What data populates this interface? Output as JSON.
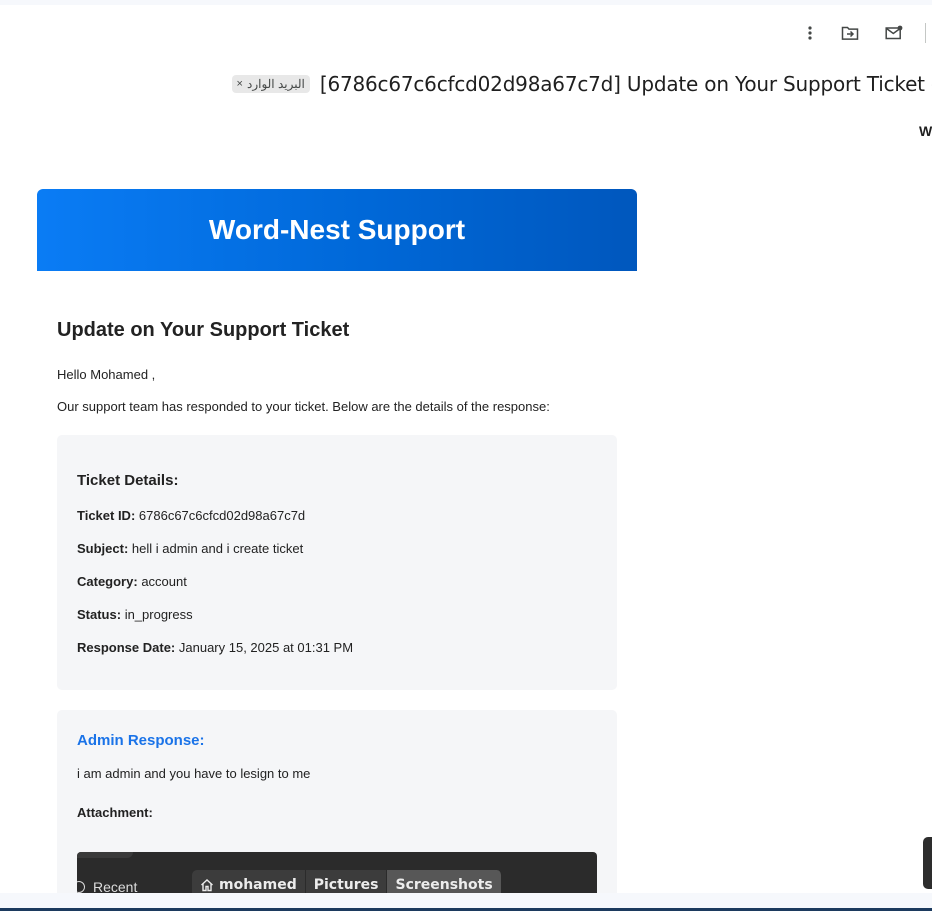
{
  "toolbar": {
    "icons": [
      "more-vert-icon",
      "move-to-icon",
      "mark-unread-icon"
    ]
  },
  "email": {
    "subject": "[6786c67c6cfcd02d98a67c7d] Update on Your Support Ticket -",
    "label": "البريد الوارد",
    "label_close": "×",
    "sender_truncated": "W"
  },
  "message": {
    "brand": "Word-Nest Support",
    "heading": "Update on Your Support Ticket",
    "greeting": "Hello Mohamed ,",
    "intro": "Our support team has responded to your ticket. Below are the details of the response:"
  },
  "details": {
    "title": "Ticket Details:",
    "rows": [
      {
        "label": "Ticket ID:",
        "value": "6786c67c6cfcd02d98a67c7d"
      },
      {
        "label": "Subject:",
        "value": "hell i admin and i create ticket"
      },
      {
        "label": "Category:",
        "value": "account"
      },
      {
        "label": "Status:",
        "value": "in_progress"
      },
      {
        "label": "Response Date:",
        "value": "January 15, 2025 at 01:31 PM"
      }
    ]
  },
  "response": {
    "title": "Admin Response:",
    "text": "i am admin and you have to lesign to me",
    "attachment_label": "Attachment:",
    "accent": "#1a73e8"
  },
  "attachment_image": {
    "sidebar_item": "Recent",
    "crumbs": [
      "mohamed",
      "Pictures",
      "Screenshots"
    ]
  }
}
